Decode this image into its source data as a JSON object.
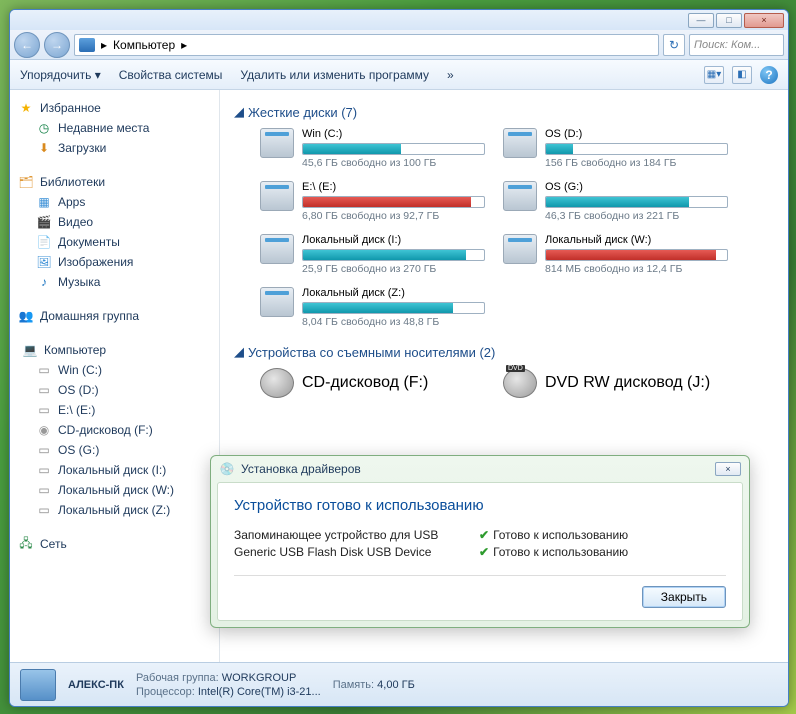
{
  "titlebar": {
    "min": "—",
    "max": "□",
    "close": "×"
  },
  "nav": {
    "back": "←",
    "fwd": "→",
    "breadcrumb_root": "▸",
    "breadcrumb": "Компьютер",
    "refresh": "↻",
    "search_placeholder": "Поиск: Ком..."
  },
  "toolbar": {
    "organize": "Упорядочить  ▾",
    "sysprops": "Свойства системы",
    "uninstall": "Удалить или изменить программу",
    "more": "»",
    "help": "?"
  },
  "sidebar": {
    "fav_head": "Избранное",
    "fav": [
      "Недавние места",
      "Загрузки"
    ],
    "lib_head": "Библиотеки",
    "lib": [
      "Apps",
      "Видео",
      "Документы",
      "Изображения",
      "Музыка"
    ],
    "homegroup": "Домашняя группа",
    "comp_head": "Компьютер",
    "comp": [
      "Win (C:)",
      "OS (D:)",
      "E:\\ (E:)",
      "CD-дисковод (F:)",
      "OS (G:)",
      "Локальный диск (I:)",
      "Локальный диск (W:)",
      "Локальный диск (Z:)"
    ],
    "network": "Сеть"
  },
  "sections": {
    "hdd": "Жесткие диски (7)",
    "removable": "Устройства со съемными носителями (2)"
  },
  "drives": [
    {
      "name": "Win (C:)",
      "stat": "45,6 ГБ свободно из 100 ГБ",
      "fill": 54,
      "color": "teal"
    },
    {
      "name": "OS (D:)",
      "stat": "156 ГБ свободно из 184 ГБ",
      "fill": 15,
      "color": "teal"
    },
    {
      "name": "E:\\ (E:)",
      "stat": "6,80 ГБ свободно из 92,7 ГБ",
      "fill": 93,
      "color": "red"
    },
    {
      "name": "OS (G:)",
      "stat": "46,3 ГБ свободно из 221 ГБ",
      "fill": 79,
      "color": "teal"
    },
    {
      "name": "Локальный диск (I:)",
      "stat": "25,9 ГБ свободно из 270 ГБ",
      "fill": 90,
      "color": "teal"
    },
    {
      "name": "Локальный диск (W:)",
      "stat": "814 МБ свободно из 12,4 ГБ",
      "fill": 94,
      "color": "red"
    },
    {
      "name": "Локальный диск (Z:)",
      "stat": "8,04 ГБ свободно из 48,8 ГБ",
      "fill": 83,
      "color": "teal"
    }
  ],
  "removable": [
    {
      "name": "CD-дисковод (F:)",
      "type": "cd"
    },
    {
      "name": "DVD RW дисковод (J:)",
      "type": "dvd"
    }
  ],
  "status": {
    "name": "АЛЕКС-ПК",
    "wg_lbl": "Рабочая группа:",
    "wg": "WORKGROUP",
    "cpu_lbl": "Процессор:",
    "cpu": "Intel(R) Core(TM) i3-21...",
    "mem_lbl": "Память:",
    "mem": "4,00 ГБ"
  },
  "popup": {
    "title": "Установка драйверов",
    "heading": "Устройство готово к использованию",
    "rows": [
      {
        "dev": "Запоминающее устройство для USB",
        "stat": "Готово к использованию"
      },
      {
        "dev": "Generic USB Flash Disk USB Device",
        "stat": "Готово к использованию"
      }
    ],
    "close": "Закрыть"
  }
}
